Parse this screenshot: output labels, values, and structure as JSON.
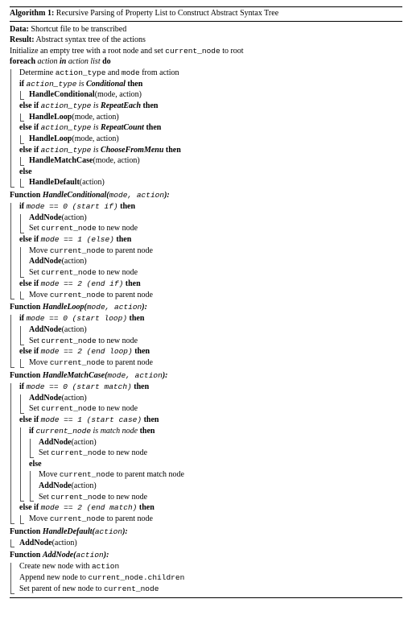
{
  "algo": {
    "number": "Algorithm 1:",
    "title": "Recursive Parsing of Property List to Construct Abstract Syntax Tree",
    "data_label": "Data:",
    "data_val": "Shortcut file to be transcribed",
    "result_label": "Result:",
    "result_val": "Abstract syntax tree of the actions",
    "init_a": "Initialize an empty tree with a root node and set ",
    "init_tt": "current_node",
    "init_b": " to root",
    "foreach": {
      "kw": "foreach ",
      "var": "action ",
      "in": "in ",
      "list": "action list ",
      "do": "do"
    },
    "det_a": "Determine ",
    "det_tt1": "action_type",
    "det_b": " and ",
    "det_tt2": "mode",
    "det_c": " from action",
    "if": "if ",
    "elseif": "else if ",
    "else": "else",
    "then": " then",
    "is": " is ",
    "types": {
      "t1": "Conditional",
      "t2": "RepeatEach",
      "t3": "RepeatCount",
      "t4": "ChooseFromMenu"
    },
    "calls": {
      "hc": "HandleConditional",
      "hl": "HandleLoop",
      "hm": "HandleMatchCase",
      "hd": "HandleDefault",
      "args_ma": "(mode, action)",
      "args_a": "(action)"
    },
    "fn_kw": "Function ",
    "fn_hc": "HandleConditional(",
    "fn_hc_args": "mode, action",
    "fn_close": "):",
    "fn_hl": "HandleLoop(",
    "fn_hm": "HandleMatchCase(",
    "fn_hd": "HandleDefault(",
    "fn_hd_args": "action",
    "fn_an": "AddNode(",
    "modes": {
      "m0if": "mode == 0 (start if)",
      "m1else": "mode == 1 (else)",
      "m2endif": "mode == 2 (end if)",
      "m0loop": "mode == 0 (start loop)",
      "m2endloop": "mode == 2 (end loop)",
      "m0match": "mode == 0 (start match)",
      "m1case": "mode == 1 (start case)",
      "m2endmatch": "mode == 2 (end match)"
    },
    "addnode": "AddNode",
    "addnode_arg": "(action)",
    "set_a": "Set ",
    "set_b": " to new node",
    "move_a": "Move ",
    "move_b": " to parent node",
    "move_c": " to parent match node",
    "cn": "current_node",
    "isnode_a": " is match node",
    "an_l1_a": "Create new node with ",
    "an_l1_tt": "action",
    "an_l2_a": "Append new node to ",
    "an_l2_tt": "current_node.children",
    "an_l3_a": "Set parent of new node to "
  }
}
